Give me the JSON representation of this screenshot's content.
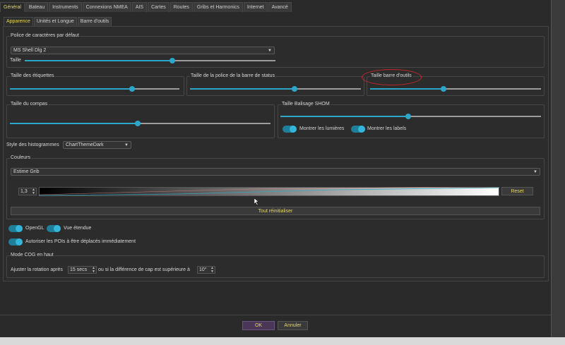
{
  "tabs": [
    {
      "label": "Général",
      "active": true
    },
    {
      "label": "Bateau"
    },
    {
      "label": "Instruments"
    },
    {
      "label": "Connexions NMEA"
    },
    {
      "label": "AIS"
    },
    {
      "label": "Cartes"
    },
    {
      "label": "Routes"
    },
    {
      "label": "Gribs et Harmonics"
    },
    {
      "label": "Internet"
    },
    {
      "label": "Avancé"
    }
  ],
  "subtabs": [
    {
      "label": "Apparence",
      "active": true
    },
    {
      "label": "Unités et Longue"
    },
    {
      "label": "Barre d'outils"
    }
  ],
  "font_group": {
    "title": "Police de caractères par défaut",
    "font_value": "MS Shell Dlg 2",
    "size_label": "Taille",
    "size_value": 0.59
  },
  "labels_size": {
    "title": "Taille des étiquettes",
    "value": 0.72
  },
  "status_font_size": {
    "title": "Taille de la police de la barre de status",
    "value": 0.61
  },
  "toolbar_size": {
    "title": "Taille barre d'outils",
    "value": 0.43
  },
  "compass_size": {
    "title": "Taille du compas",
    "value": 0.49
  },
  "shom": {
    "title": "Taille Balisage SHOM",
    "value": 0.49,
    "lights_label": "Montrer les lumières",
    "labels_label": "Montrer les labels"
  },
  "histogram": {
    "label": "Style des histogrammes",
    "value": "ChartThemeDark"
  },
  "colors": {
    "title": "Couleurs",
    "combo_value": "Estime Grib",
    "spin_value": "1,3",
    "reset_label": "Reset",
    "reset_all_label": "Tout réinitialiser"
  },
  "opengl_label": "OpenGL",
  "extended_view_label": "Vue étendue",
  "poi_label": "Autoriser les POIs à être déplacés immédiatement",
  "cog": {
    "title": "Mode COG en haut",
    "text1": "Ajuster la rotation après",
    "secs_value": "15 secs",
    "text2": "ou si la différence de cap est supérieure à",
    "deg_value": "10°"
  },
  "buttons": {
    "ok": "OK",
    "cancel": "Annuler"
  },
  "accent_color": "#2ca6c9",
  "highlight_color": "#e6d85a",
  "annotation_color": "#c1272d"
}
